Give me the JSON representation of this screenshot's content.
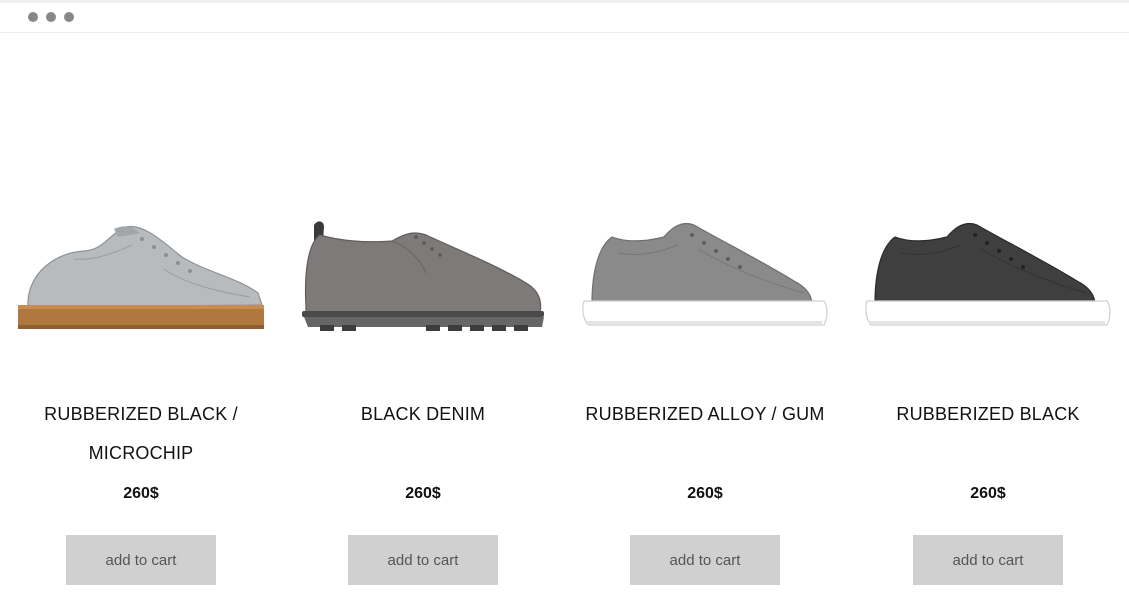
{
  "window": {
    "controls": [
      "window-dot",
      "window-dot",
      "window-dot"
    ]
  },
  "products": [
    {
      "name": "RUBBERIZED BLACK / MICROCHIP",
      "price": "260$",
      "button_label": "add to cart",
      "image": "light-grey-sneaker-gum-sole"
    },
    {
      "name": "BLACK DENIM",
      "price": "260$",
      "button_label": "add to cart",
      "image": "grey-suede-derby-shoe"
    },
    {
      "name": "RUBBERIZED ALLOY / GUM",
      "price": "260$",
      "button_label": "add to cart",
      "image": "grey-felt-sneaker-white-sole"
    },
    {
      "name": "RUBBERIZED BLACK",
      "price": "260$",
      "button_label": "add to cart",
      "image": "dark-grey-felt-sneaker-white-sole"
    }
  ],
  "colors": {
    "button_bg": "#d0d0d0",
    "button_text": "#555555",
    "gum_sole": "#b0773f",
    "light_grey_leather": "#b8bbbd",
    "suede_grey": "#7d7a79",
    "felt_grey": "#8a8a8a",
    "felt_dark": "#3f3f3f"
  }
}
